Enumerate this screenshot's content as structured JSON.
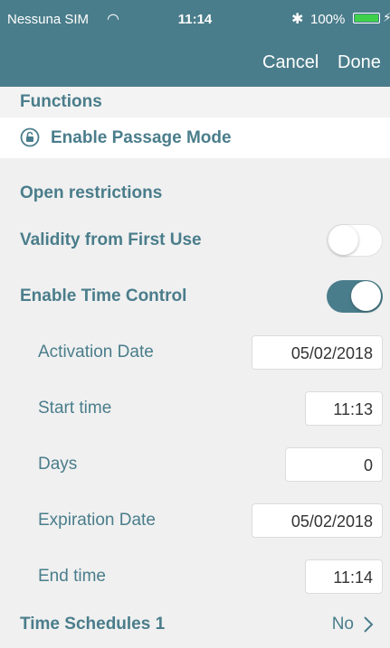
{
  "status_bar": {
    "carrier": "Nessuna SIM",
    "wifi_icon": "◠",
    "time": "11:14",
    "bluetooth_icon": "✱",
    "battery": "100%",
    "charging_icon": "⚡",
    "battery_color": "#3fd14a"
  },
  "nav": {
    "cancel": "Cancel",
    "done": "Done"
  },
  "functions": {
    "header": "Functions",
    "passage_mode": "Enable Passage Mode"
  },
  "open_restrictions": {
    "header": "Open restrictions"
  },
  "validity": {
    "label": "Validity from First Use",
    "enabled": false
  },
  "time_control": {
    "label": "Enable Time Control",
    "enabled": true
  },
  "activation_date": {
    "label": "Activation Date",
    "value": "05/02/2018"
  },
  "start_time": {
    "label": "Start time",
    "value": "11:13"
  },
  "days": {
    "label": "Days",
    "value": "0"
  },
  "expiration_date": {
    "label": "Expiration Date",
    "value": "05/02/2018"
  },
  "end_time": {
    "label": "End time",
    "value": "11:14"
  },
  "time_schedules": {
    "label": "Time Schedules 1",
    "value": "No"
  },
  "colors": {
    "accent": "#4a7d8b",
    "background": "#f0f0f0",
    "toggle_on": "#4a7d8b"
  }
}
